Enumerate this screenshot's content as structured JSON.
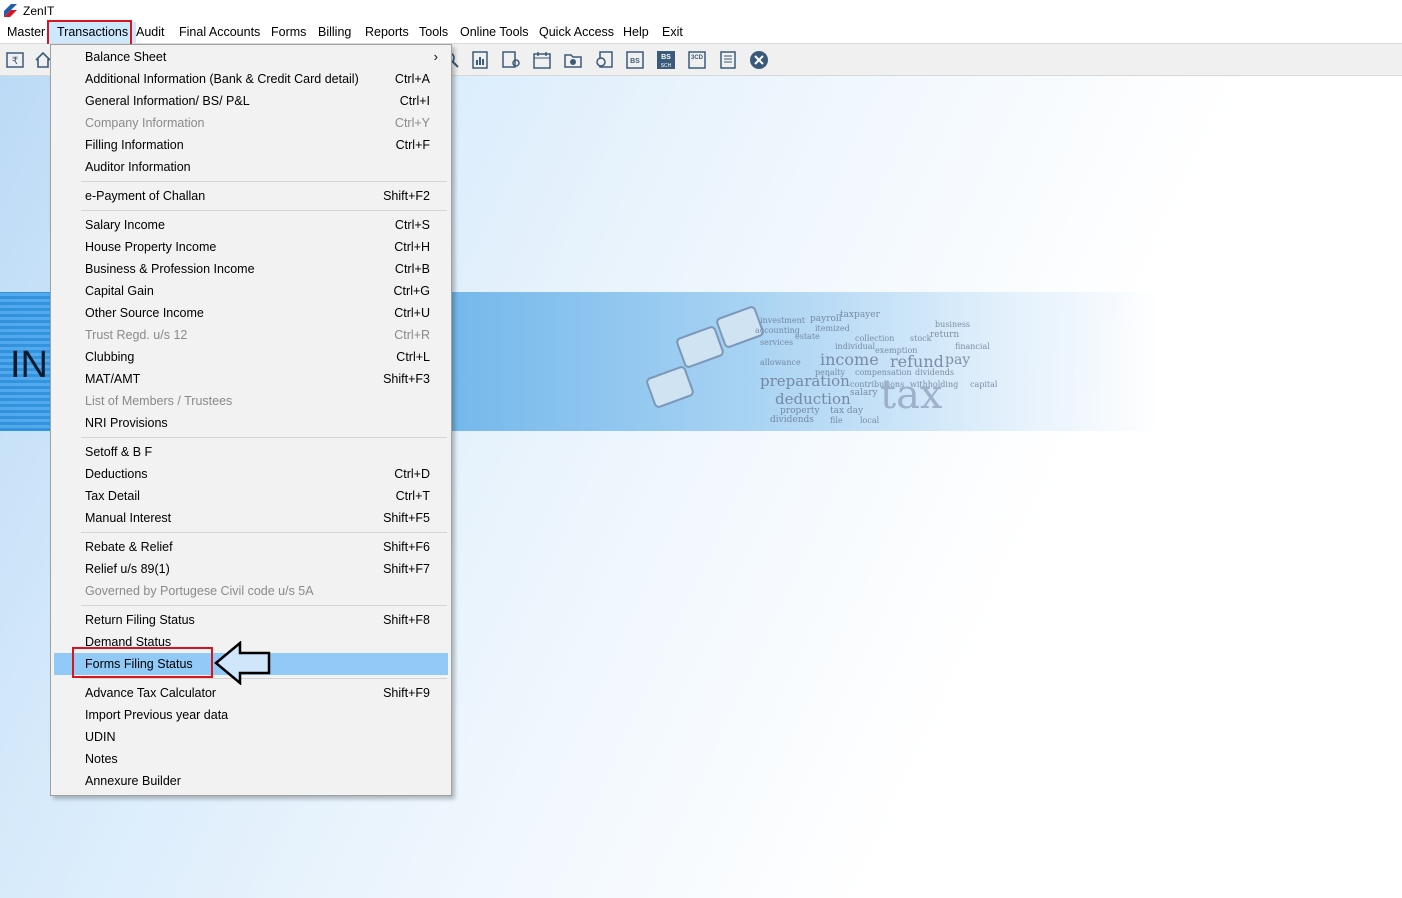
{
  "app": {
    "title": "ZenIT"
  },
  "menubar": [
    {
      "label": "Master"
    },
    {
      "label": "Transactions"
    },
    {
      "label": "Audit"
    },
    {
      "label": "Final Accounts"
    },
    {
      "label": "Forms"
    },
    {
      "label": "Billing"
    },
    {
      "label": "Reports"
    },
    {
      "label": "Tools"
    },
    {
      "label": "Online Tools"
    },
    {
      "label": "Quick Access"
    },
    {
      "label": "Help"
    },
    {
      "label": "Exit"
    }
  ],
  "toolbar_icons": [
    "challan-icon",
    "home-icon",
    "search-icon",
    "report-icon",
    "user-doc-icon",
    "calendar-icon",
    "folder-add-icon",
    "search-doc-icon",
    "bs-icon",
    "bs-sch-icon",
    "3cd-icon",
    "form-icon",
    "close-icon"
  ],
  "toolbar_labels": {
    "bs": "BS",
    "bs_sch_top": "BS",
    "bs_sch_bottom": "SCH",
    "cd": "3CD"
  },
  "banner": {
    "text": "INC",
    "words": [
      "taxpayer",
      "payroll",
      "itemized",
      "investment",
      "accounting",
      "return",
      "estate",
      "collection",
      "stock",
      "services",
      "individual",
      "business",
      "exemption",
      "financial",
      "income",
      "refund",
      "pay",
      "allowance",
      "penalty",
      "compensation",
      "dividends",
      "preparation",
      "contributions",
      "withholding",
      "salary",
      "tax",
      "deduction",
      "capital",
      "property",
      "tax day",
      "dividends",
      "file",
      "local"
    ]
  },
  "transactions_menu": {
    "items": [
      {
        "label": "Balance Sheet",
        "shortcut": "",
        "submenu": true
      },
      {
        "label": "Additional Information (Bank & Credit Card detail)",
        "shortcut": "Ctrl+A"
      },
      {
        "label": "General Information/ BS/ P&L",
        "shortcut": "Ctrl+I"
      },
      {
        "label": "Company Information",
        "shortcut": "Ctrl+Y",
        "disabled": true
      },
      {
        "label": "Filling Information",
        "shortcut": "Ctrl+F"
      },
      {
        "label": "Auditor Information",
        "shortcut": ""
      },
      {
        "label": "e-Payment of Challan",
        "shortcut": "Shift+F2"
      },
      {
        "label": "Salary Income",
        "shortcut": "Ctrl+S"
      },
      {
        "label": "House Property Income",
        "shortcut": "Ctrl+H"
      },
      {
        "label": "Business & Profession Income",
        "shortcut": "Ctrl+B"
      },
      {
        "label": "Capital Gain",
        "shortcut": "Ctrl+G"
      },
      {
        "label": "Other Source Income",
        "shortcut": "Ctrl+U"
      },
      {
        "label": "Trust Regd. u/s 12",
        "shortcut": "Ctrl+R",
        "disabled": true
      },
      {
        "label": "Clubbing",
        "shortcut": "Ctrl+L"
      },
      {
        "label": "MAT/AMT",
        "shortcut": "Shift+F3"
      },
      {
        "label": "List of Members / Trustees",
        "shortcut": "",
        "disabled": true
      },
      {
        "label": "NRI Provisions",
        "shortcut": ""
      },
      {
        "label": "Setoff & B F",
        "shortcut": ""
      },
      {
        "label": "Deductions",
        "shortcut": "Ctrl+D"
      },
      {
        "label": "Tax Detail",
        "shortcut": "Ctrl+T"
      },
      {
        "label": "Manual Interest",
        "shortcut": "Shift+F5"
      },
      {
        "label": "Rebate & Relief",
        "shortcut": "Shift+F6"
      },
      {
        "label": "Relief u/s 89(1)",
        "shortcut": "Shift+F7"
      },
      {
        "label": "Governed by Portugese Civil code u/s 5A",
        "shortcut": "",
        "disabled": true
      },
      {
        "label": "Return Filing Status",
        "shortcut": "Shift+F8"
      },
      {
        "label": "Demand Status",
        "shortcut": ""
      },
      {
        "label": "Forms Filing Status",
        "shortcut": "",
        "highlighted": true
      },
      {
        "label": "Advance Tax Calculator",
        "shortcut": "Shift+F9"
      },
      {
        "label": "Import Previous year data",
        "shortcut": ""
      },
      {
        "label": "UDIN",
        "shortcut": ""
      },
      {
        "label": "Notes",
        "shortcut": ""
      },
      {
        "label": "Annexure Builder",
        "shortcut": ""
      }
    ]
  },
  "colors": {
    "highlight": "#91c9f7",
    "annotation_red": "#d8141c",
    "arrow_fill": "#cfe6fb"
  }
}
